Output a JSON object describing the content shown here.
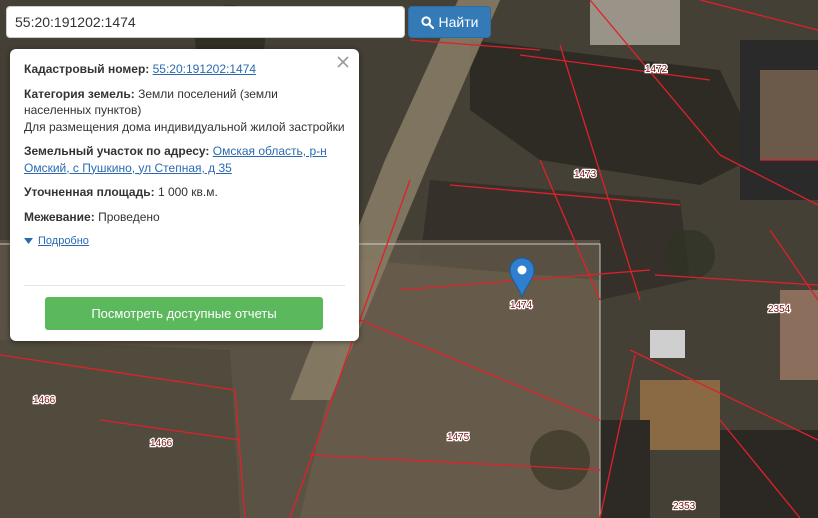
{
  "search": {
    "value": "55:20:191202:1474",
    "button_label": "Найти"
  },
  "popup": {
    "cadastral_label": "Кадастровый номер:",
    "cadastral_value": "55:20:191202:1474",
    "category_label": "Категория земель:",
    "category_value": "Земли поселений (земли населенных пунктов)",
    "purpose": "Для размещения дома индивидуальной жилой застройки",
    "address_label": "Земельный участок по адресу:",
    "address_value": "Омская область, р-н Омский, с Пушкино, ул Степная, д 35",
    "area_label": "Уточненная площадь:",
    "area_value": "1 000 кв.м.",
    "survey_label": "Межевание:",
    "survey_value": "Проведено",
    "more_link": "Подробно",
    "report_button": "Посмотреть доступные отчеты"
  },
  "map": {
    "parcel_labels": [
      "1472",
      "1473",
      "1474",
      "1475",
      "1466",
      "1466",
      "2354",
      "2353"
    ],
    "marker_parcel": "1474",
    "boundary_color": "#e0202a",
    "accent_color": "#337ab7",
    "button_color": "#5cb85c"
  }
}
